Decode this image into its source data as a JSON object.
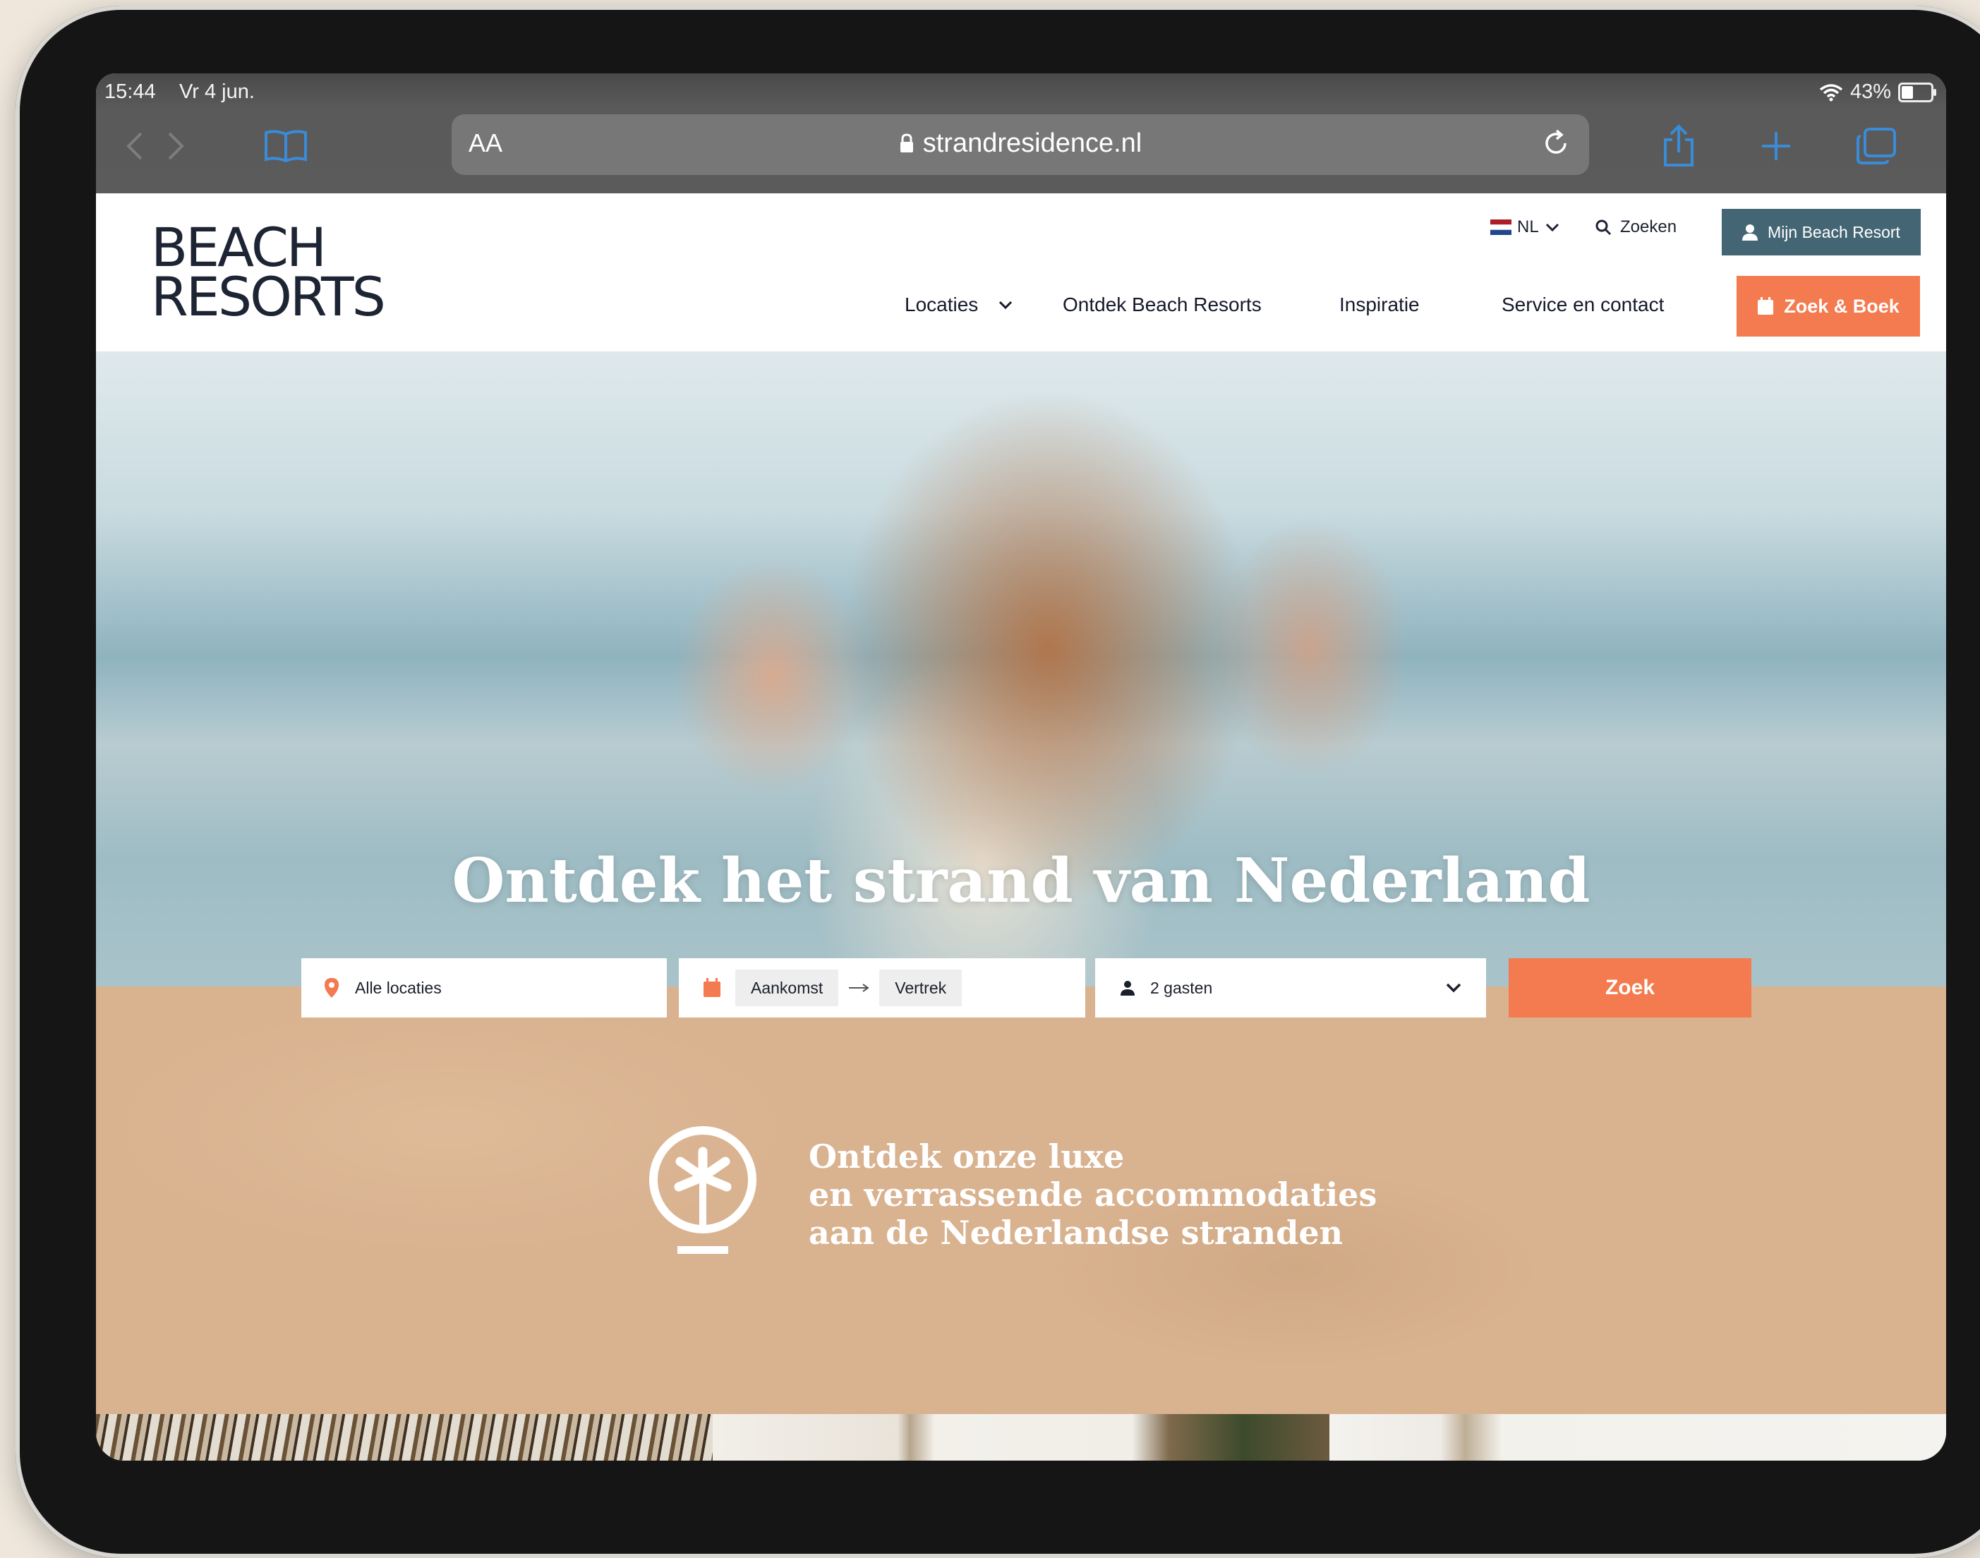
{
  "status_bar": {
    "time": "15:44",
    "date": "Vr 4 jun.",
    "battery": "43%"
  },
  "browser": {
    "text_size_label": "AA",
    "url": "strandresidence.nl",
    "icons": [
      "back-icon",
      "forward-icon",
      "bookmarks-icon",
      "share-icon",
      "plus-icon",
      "tabs-icon",
      "reload-icon",
      "lock-icon",
      "wifi-icon",
      "battery-icon"
    ]
  },
  "header": {
    "logo_line1": "BEACH",
    "logo_line2": "RESORTS",
    "language": "NL",
    "search_label": "Zoeken",
    "account_label": "Mijn Beach Resort",
    "nav": [
      "Locaties",
      "Ontdek Beach Resorts",
      "Inspiratie",
      "Service en contact"
    ],
    "cta_label": "Zoek & Boek"
  },
  "hero": {
    "title": "Ontdek het strand van Nederland"
  },
  "search": {
    "location": "Alle locaties",
    "arrival": "Aankomst",
    "departure": "Vertrek",
    "guests": "2 gasten",
    "button": "Zoek"
  },
  "intro": {
    "line1": "Ontdek onze luxe",
    "line2": "en verrassende accommodaties",
    "line3": "aan de Nederlandse stranden"
  },
  "colors": {
    "accent": "#f47a4f",
    "account": "#446674",
    "sand": "#d9b290",
    "text": "#15192a"
  }
}
